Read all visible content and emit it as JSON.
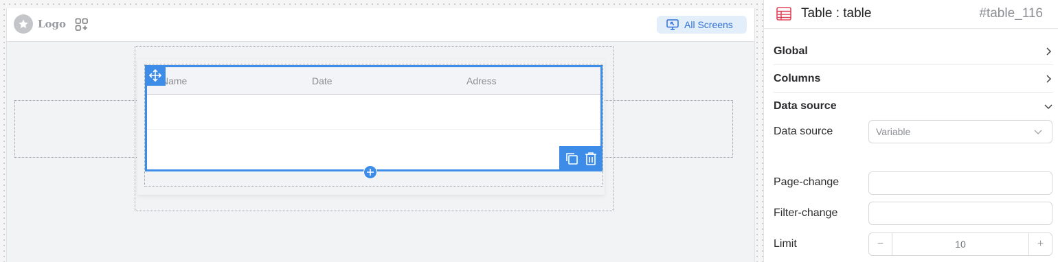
{
  "canvas": {
    "logo_text": "Logo",
    "all_screens_label": "All Screens",
    "table": {
      "columns": [
        "Name",
        "Date",
        "Adress"
      ]
    }
  },
  "panel": {
    "title": "Table : table",
    "id": "#table_116",
    "sections": {
      "global": "Global",
      "columns": "Columns",
      "data_source": "Data source"
    },
    "fields": {
      "data_source_label": "Data source",
      "data_source_value": "Variable",
      "page_change_label": "Page-change",
      "page_change_value": "",
      "filter_change_label": "Filter-change",
      "filter_change_value": "",
      "limit_label": "Limit",
      "limit_value": "10"
    }
  },
  "colors": {
    "accent": "#3d8de8",
    "all_screens_bg": "#e3eefb",
    "all_screens_text": "#2f6fd6",
    "table_icon": "#e0475b"
  }
}
